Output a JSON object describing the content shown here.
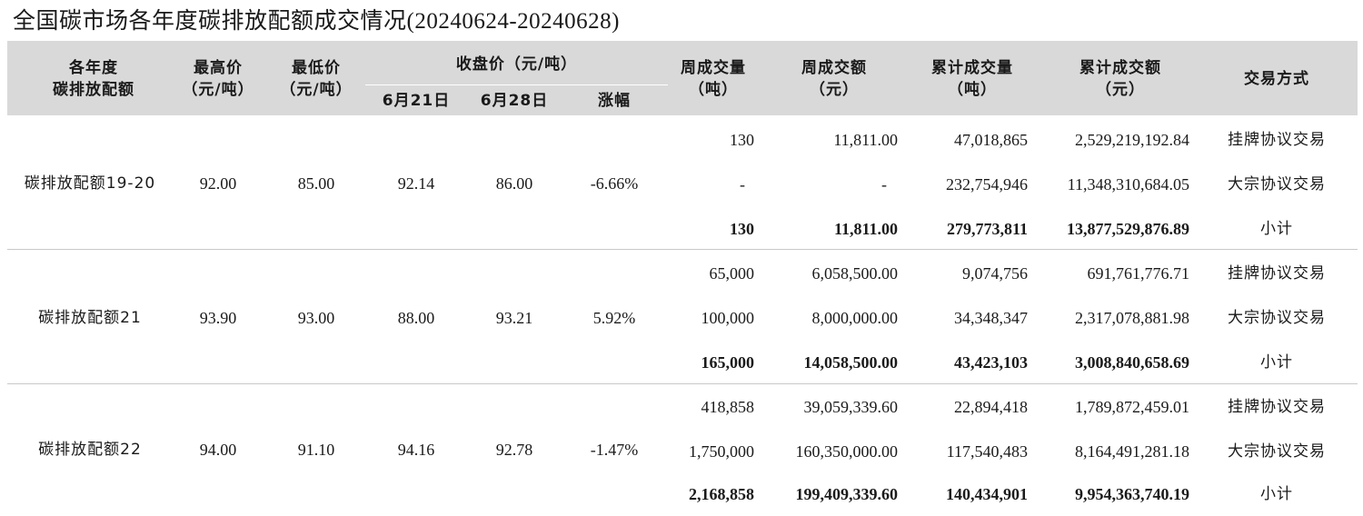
{
  "title": "全国碳市场各年度碳排放配额成交情况(20240624-20240628)",
  "header": {
    "col_year_1": "各年度",
    "col_year_2": "碳排放配额",
    "col_high_1": "最高价",
    "col_high_2": "（元/吨）",
    "col_low_1": "最低价",
    "col_low_2": "（元/吨）",
    "col_close": "收盘价（元/吨）",
    "col_close_d1": "6月21日",
    "col_close_d2": "6月28日",
    "col_change": "涨幅",
    "col_wvol_1": "周成交量",
    "col_wvol_2": "（吨）",
    "col_wamt_1": "周成交额",
    "col_wamt_2": "（元）",
    "col_cvol_1": "累计成交量",
    "col_cvol_2": "（吨）",
    "col_camt_1": "累计成交额",
    "col_camt_2": "（元）",
    "col_mode": "交易方式"
  },
  "groups": [
    {
      "name": "碳排放配额19-20",
      "high": "92.00",
      "low": "85.00",
      "close_0621": "92.14",
      "close_0628": "86.00",
      "change": "-6.66%",
      "rows": [
        {
          "wvol": "130",
          "wamt": "11,811.00",
          "cvol": "47,018,865",
          "camt": "2,529,219,192.84",
          "mode": "挂牌协议交易"
        },
        {
          "wvol": "-",
          "wamt": "-",
          "cvol": "232,754,946",
          "camt": "11,348,310,684.05",
          "mode": "大宗协议交易"
        },
        {
          "wvol": "130",
          "wamt": "11,811.00",
          "cvol": "279,773,811",
          "camt": "13,877,529,876.89",
          "mode": "小计"
        }
      ]
    },
    {
      "name": "碳排放配额21",
      "high": "93.90",
      "low": "93.00",
      "close_0621": "88.00",
      "close_0628": "93.21",
      "change": "5.92%",
      "rows": [
        {
          "wvol": "65,000",
          "wamt": "6,058,500.00",
          "cvol": "9,074,756",
          "camt": "691,761,776.71",
          "mode": "挂牌协议交易"
        },
        {
          "wvol": "100,000",
          "wamt": "8,000,000.00",
          "cvol": "34,348,347",
          "camt": "2,317,078,881.98",
          "mode": "大宗协议交易"
        },
        {
          "wvol": "165,000",
          "wamt": "14,058,500.00",
          "cvol": "43,423,103",
          "camt": "3,008,840,658.69",
          "mode": "小计"
        }
      ]
    },
    {
      "name": "碳排放配额22",
      "high": "94.00",
      "low": "91.10",
      "close_0621": "94.16",
      "close_0628": "92.78",
      "change": "-1.47%",
      "rows": [
        {
          "wvol": "418,858",
          "wamt": "39,059,339.60",
          "cvol": "22,894,418",
          "camt": "1,789,872,459.01",
          "mode": "挂牌协议交易"
        },
        {
          "wvol": "1,750,000",
          "wamt": "160,350,000.00",
          "cvol": "117,540,483",
          "camt": "8,164,491,281.18",
          "mode": "大宗协议交易"
        },
        {
          "wvol": "2,168,858",
          "wamt": "199,409,339.60",
          "cvol": "140,434,901",
          "camt": "9,954,363,740.19",
          "mode": "小计"
        }
      ]
    }
  ]
}
